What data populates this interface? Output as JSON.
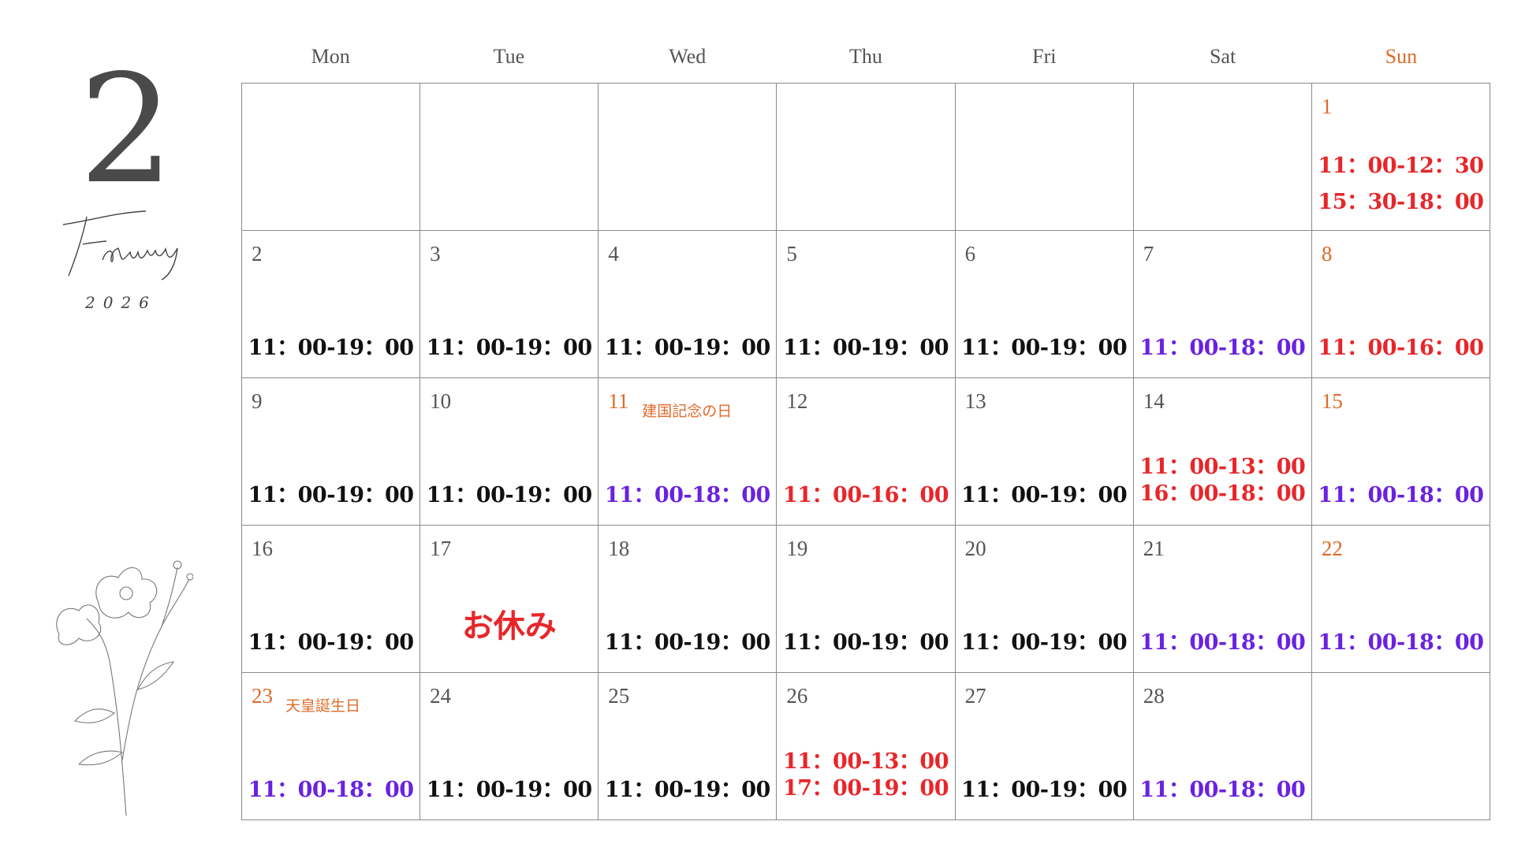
{
  "title": {
    "month_number": "2",
    "month_name": "February",
    "year": "2026"
  },
  "weekdays": [
    {
      "label": "Mon",
      "sun": false
    },
    {
      "label": "Tue",
      "sun": false
    },
    {
      "label": "Wed",
      "sun": false
    },
    {
      "label": "Thu",
      "sun": false
    },
    {
      "label": "Fri",
      "sun": false
    },
    {
      "label": "Sat",
      "sun": false
    },
    {
      "label": "Sun",
      "sun": true
    }
  ],
  "colors": {
    "black": "#111111",
    "purple": "#6a22e0",
    "red": "#e8262a",
    "sunday": "#e06a2a",
    "grid": "#8a8a8a"
  },
  "cells": [
    {},
    {},
    {},
    {},
    {},
    {},
    {
      "day": "1",
      "sun": true,
      "hours": [
        "11：00-12：30",
        "15：30-18：00"
      ],
      "color": "red"
    },
    {
      "day": "2",
      "hours": [
        "11：00-19：00"
      ],
      "color": "black"
    },
    {
      "day": "3",
      "hours": [
        "11：00-19：00"
      ],
      "color": "black"
    },
    {
      "day": "4",
      "hours": [
        "11：00-19：00"
      ],
      "color": "black"
    },
    {
      "day": "5",
      "hours": [
        "11：00-19：00"
      ],
      "color": "black"
    },
    {
      "day": "6",
      "hours": [
        "11：00-19：00"
      ],
      "color": "black"
    },
    {
      "day": "7",
      "hours": [
        "11：00-18：00"
      ],
      "color": "purple"
    },
    {
      "day": "8",
      "sun": true,
      "hours": [
        "11：00-16：00"
      ],
      "color": "red"
    },
    {
      "day": "9",
      "hours": [
        "11：00-19：00"
      ],
      "color": "black"
    },
    {
      "day": "10",
      "hours": [
        "11：00-19：00"
      ],
      "color": "black"
    },
    {
      "day": "11",
      "holiday": "建国記念の日",
      "hours": [
        "11：00-18：00"
      ],
      "color": "purple"
    },
    {
      "day": "12",
      "hours": [
        "11：00-16：00"
      ],
      "color": "red"
    },
    {
      "day": "13",
      "hours": [
        "11：00-19：00"
      ],
      "color": "black"
    },
    {
      "day": "14",
      "hours": [
        "11：00-13：00",
        "16：00-18：00"
      ],
      "color": "red"
    },
    {
      "day": "15",
      "sun": true,
      "hours": [
        "11：00-18：00"
      ],
      "color": "purple"
    },
    {
      "day": "16",
      "hours": [
        "11：00-19：00"
      ],
      "color": "black"
    },
    {
      "day": "17",
      "closed": "お休み"
    },
    {
      "day": "18",
      "hours": [
        "11：00-19：00"
      ],
      "color": "black"
    },
    {
      "day": "19",
      "hours": [
        "11：00-19：00"
      ],
      "color": "black"
    },
    {
      "day": "20",
      "hours": [
        "11：00-19：00"
      ],
      "color": "black"
    },
    {
      "day": "21",
      "hours": [
        "11：00-18：00"
      ],
      "color": "purple"
    },
    {
      "day": "22",
      "sun": true,
      "hours": [
        "11：00-18：00"
      ],
      "color": "purple"
    },
    {
      "day": "23",
      "holiday": "天皇誕生日",
      "hours": [
        "11：00-18：00"
      ],
      "color": "purple"
    },
    {
      "day": "24",
      "hours": [
        "11：00-19：00"
      ],
      "color": "black"
    },
    {
      "day": "25",
      "hours": [
        "11：00-19：00"
      ],
      "color": "black"
    },
    {
      "day": "26",
      "hours": [
        "11：00-13：00",
        "17：00-19：00"
      ],
      "color": "red"
    },
    {
      "day": "27",
      "hours": [
        "11：00-19：00"
      ],
      "color": "black"
    },
    {
      "day": "28",
      "hours": [
        "11：00-18：00"
      ],
      "color": "purple"
    },
    {}
  ]
}
